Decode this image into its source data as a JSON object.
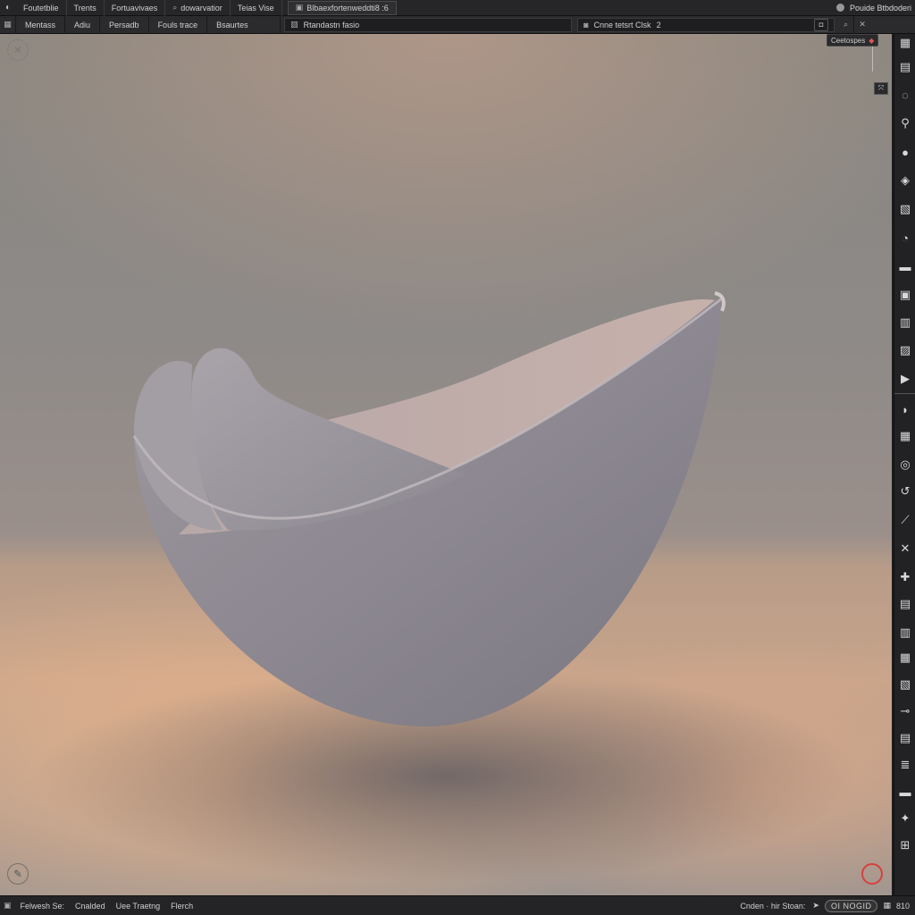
{
  "menubar": {
    "items": [
      "Foutetblie",
      "Trents",
      "Fortuavivaes",
      "dowarvatior",
      "Teias Vise"
    ],
    "project_field": "Blbaexfortenweddti8 :6",
    "right_label": "Pouide Btbdoderi"
  },
  "tabbar": {
    "tabs": [
      "Mentass",
      "Adiu",
      "Persadb",
      "Fouls trace",
      "Bsaurtes"
    ],
    "field_left": "Rtandastn fasio",
    "field_right": "Cnne tetsrt Clsk",
    "field_right_suffix": "2"
  },
  "viewport": {
    "collection_chip": "Ceetospes",
    "top_left_icon": "close-circle-icon",
    "bottom_left_icon": "pen-nib-icon"
  },
  "toolbar": {
    "icons": [
      "grid-icon",
      "lasso-icon",
      "pipette-icon",
      "info-icon",
      "shield-icon",
      "cube-icon",
      "paint-icon",
      "brush-icon",
      "image-icon",
      "layers-icon",
      "frame-icon",
      "play-icon",
      "half-circle-icon",
      "texture-icon",
      "vector-icon",
      "curve-icon",
      "measure-icon",
      "cross-icon",
      "puzzle-icon",
      "node-icon",
      "mesh-icon",
      "select-icon",
      "transform-icon",
      "link-icon",
      "stack-icon",
      "list-icon",
      "star-icon",
      "export-icon"
    ]
  },
  "statusbar": {
    "left_items": [
      "Felwesh Se:",
      "Cnalded",
      "Uee Traetng",
      "Flerch"
    ],
    "right_text": "Cnden · hir Stoan:",
    "pill": "OI NOGID",
    "right_value": "810"
  },
  "colors": {
    "accent_red": "#e05555",
    "panel": "#262628"
  }
}
